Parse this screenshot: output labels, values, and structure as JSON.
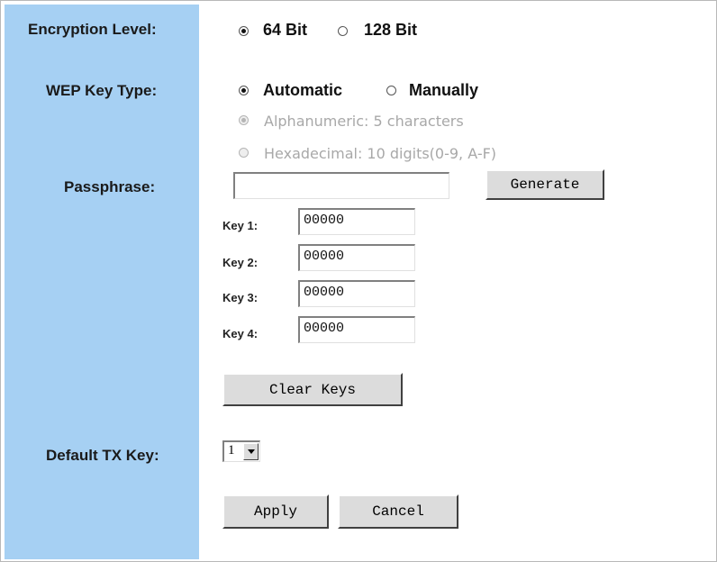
{
  "labels": {
    "encryption_level": "Encryption Level:",
    "wep_key_type": "WEP Key Type:",
    "passphrase": "Passphrase:",
    "default_tx_key": "Default TX Key:"
  },
  "encryption": {
    "options": [
      "64 Bit",
      "128 Bit"
    ],
    "selected": "64 Bit"
  },
  "wep_key_type": {
    "options": [
      "Automatic",
      "Manually"
    ],
    "selected": "Automatic",
    "sub_options": [
      "Alphanumeric: 5 characters",
      "Hexadecimal: 10 digits(0-9, A-F)"
    ],
    "sub_selected": "Alphanumeric: 5 characters"
  },
  "passphrase": {
    "value": ""
  },
  "buttons": {
    "generate": "Generate",
    "clear_keys": "Clear Keys",
    "apply": "Apply",
    "cancel": "Cancel"
  },
  "keys": [
    {
      "label": "Key 1:",
      "value": "00000"
    },
    {
      "label": "Key 2:",
      "value": "00000"
    },
    {
      "label": "Key 3:",
      "value": "00000"
    },
    {
      "label": "Key 4:",
      "value": "00000"
    }
  ],
  "default_tx_key": {
    "selected": "1"
  },
  "colors": {
    "sidebar": "#a6d0f3",
    "button_face": "#dcdcdc",
    "disabled_text": "#a8a8a8"
  }
}
